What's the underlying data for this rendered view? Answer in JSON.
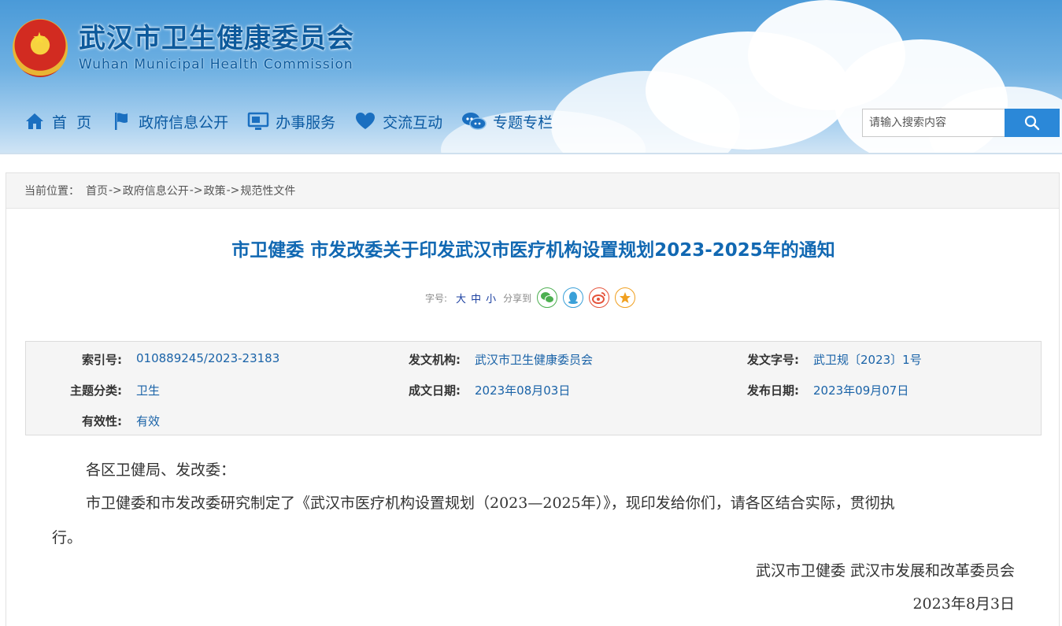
{
  "site": {
    "title_cn": "武汉市卫生健康委员会",
    "title_en": "Wuhan Municipal Health Commission"
  },
  "nav": {
    "items": [
      {
        "label": "首  页",
        "icon": "home-icon"
      },
      {
        "label": "政府信息公开",
        "icon": "flag-icon"
      },
      {
        "label": "办事服务",
        "icon": "monitor-icon"
      },
      {
        "label": "交流互动",
        "icon": "heart-icon"
      },
      {
        "label": "专题专栏",
        "icon": "chat-bubbles-icon"
      }
    ]
  },
  "search": {
    "placeholder": "请输入搜索内容",
    "button_icon": "search-icon"
  },
  "breadcrumb": {
    "prefix": "当前位置：",
    "items": [
      "首页",
      "政府信息公开",
      "政策",
      "规范性文件"
    ],
    "separator": "->"
  },
  "article": {
    "title": "市卫健委 市发改委关于印发武汉市医疗机构设置规划2023-2025年的通知",
    "tools": {
      "font_size_label": "字号:",
      "font_sizes": [
        "大",
        "中",
        "小"
      ],
      "share_label": "分享到",
      "share_targets": [
        {
          "name": "wechat-icon",
          "color": "#4caf50"
        },
        {
          "name": "qq-icon",
          "color": "#3aa0d8"
        },
        {
          "name": "weibo-icon",
          "color": "#e5533b"
        },
        {
          "name": "favorite-star-icon",
          "color": "#f0a020"
        }
      ]
    },
    "meta": {
      "index_label": "索引号:",
      "index_value": "010889245/2023-23183",
      "issuer_label": "发文机构:",
      "issuer_value": "武汉市卫生健康委员会",
      "doc_no_label": "发文字号:",
      "doc_no_value": "武卫规〔2023〕1号",
      "topic_label": "主题分类:",
      "topic_value": "卫生",
      "written_date_label": "成文日期:",
      "written_date_value": "2023年08月03日",
      "publish_date_label": "发布日期:",
      "publish_date_value": "2023年09月07日",
      "validity_label": "有效性:",
      "validity_value": "有效"
    },
    "body": {
      "salutation": "各区卫健局、发改委：",
      "paragraph_line1": "市卫健委和市发改委研究制定了《武汉市医疗机构设置规划（2023—2025年）》，现印发给你们，请各区结合实际，贯彻执",
      "paragraph_line2": "行。",
      "signature": "武汉市卫健委 武汉市发展和改革委员会",
      "date": "2023年8月3日"
    }
  },
  "colors": {
    "brand_blue": "#0d5a9c",
    "link_blue": "#1a63a8",
    "title_blue": "#1168b2",
    "search_button": "#2b88d8"
  }
}
